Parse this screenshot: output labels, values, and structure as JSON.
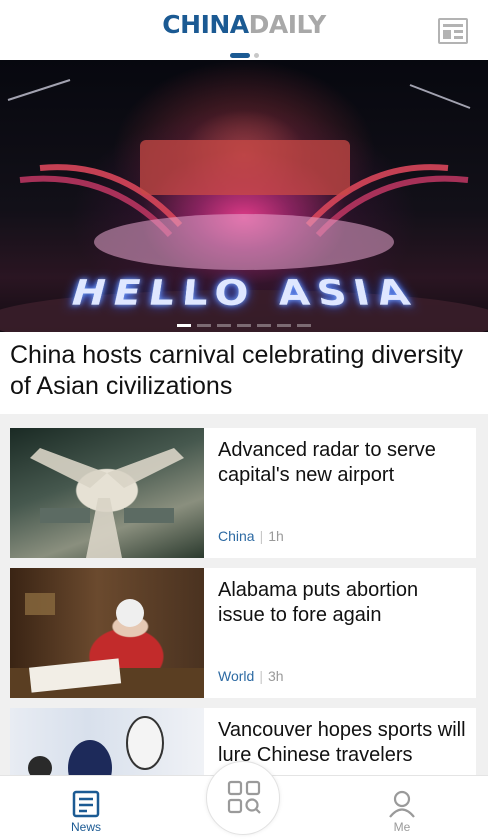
{
  "header": {
    "logo_part1": "CHINA",
    "logo_part2": "DAILY",
    "menu_icon": "newspaper-icon"
  },
  "hero": {
    "image_text": "HELLO ASIA",
    "slide_count": 7,
    "active_slide": 1,
    "headline": "China hosts carnival celebrating diversity of Asian civilizations"
  },
  "articles": [
    {
      "title": "Advanced radar to serve capital's new airport",
      "category": "China",
      "time": "1h"
    },
    {
      "title": "Alabama puts abortion issue to fore again",
      "category": "World",
      "time": "3h"
    },
    {
      "title": "Vancouver hopes sports will lure Chinese travelers",
      "category": "",
      "time": ""
    }
  ],
  "bottom_nav": {
    "news_label": "News",
    "me_label": "Me",
    "center_icon": "grid-search-icon"
  },
  "colors": {
    "brand_blue": "#1b5a93",
    "logo_gray": "#a8a8a8",
    "inactive": "#9a9a9a"
  }
}
